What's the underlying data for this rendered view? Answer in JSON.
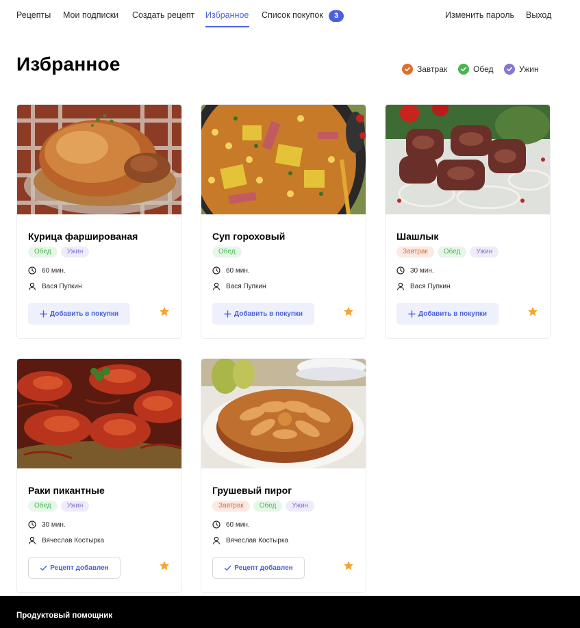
{
  "nav": {
    "items": [
      {
        "label": "Рецепты"
      },
      {
        "label": "Мои подписки"
      },
      {
        "label": "Создать рецепт"
      },
      {
        "label": "Избранное"
      },
      {
        "label": "Список покупок"
      }
    ],
    "active": "Избранное",
    "cart_count": "3",
    "change_password": "Изменить пароль",
    "logout": "Выход"
  },
  "page": {
    "title": "Избранное"
  },
  "filters": [
    {
      "label": "Завтрак",
      "color": "#e26c2d",
      "checked": true
    },
    {
      "label": "Обед",
      "color": "#49b64e",
      "checked": true
    },
    {
      "label": "Ужин",
      "color": "#8775d2",
      "checked": true
    }
  ],
  "cards": [
    {
      "title": "Курица фаршированая",
      "tags": [
        "Обед",
        "Ужин"
      ],
      "time": "60 мин.",
      "author": "Вася Пупкин",
      "button": "Добавить в покупки",
      "in_cart": false,
      "image": "roast-chicken"
    },
    {
      "title": "Суп гороховый",
      "tags": [
        "Обед"
      ],
      "time": "60 мин.",
      "author": "Вася Пупкин",
      "button": "Добавить в покупки",
      "in_cart": false,
      "image": "pea-soup"
    },
    {
      "title": "Шашлык",
      "tags": [
        "Завтрак",
        "Обед",
        "Ужин"
      ],
      "time": "30 мин.",
      "author": "Вася Пупкин",
      "button": "Добавить в покупки",
      "in_cart": false,
      "image": "shashlik"
    },
    {
      "title": "Раки пикантные",
      "tags": [
        "Обед",
        "Ужин"
      ],
      "time": "30 мин.",
      "author": "Вячеслав Костырка",
      "button": "Рецепт добавлен",
      "in_cart": true,
      "image": "crayfish"
    },
    {
      "title": "Грушевый пирог",
      "tags": [
        "Завтрак",
        "Обед",
        "Ужин"
      ],
      "time": "60 мин.",
      "author": "Вячеслав Костырка",
      "button": "Рецепт добавлен",
      "in_cart": true,
      "image": "pear-pie"
    }
  ],
  "colors": {
    "accent": "#4a61dd",
    "star": "#f3a530"
  },
  "footer": {
    "text": "Продуктовый помощник"
  }
}
